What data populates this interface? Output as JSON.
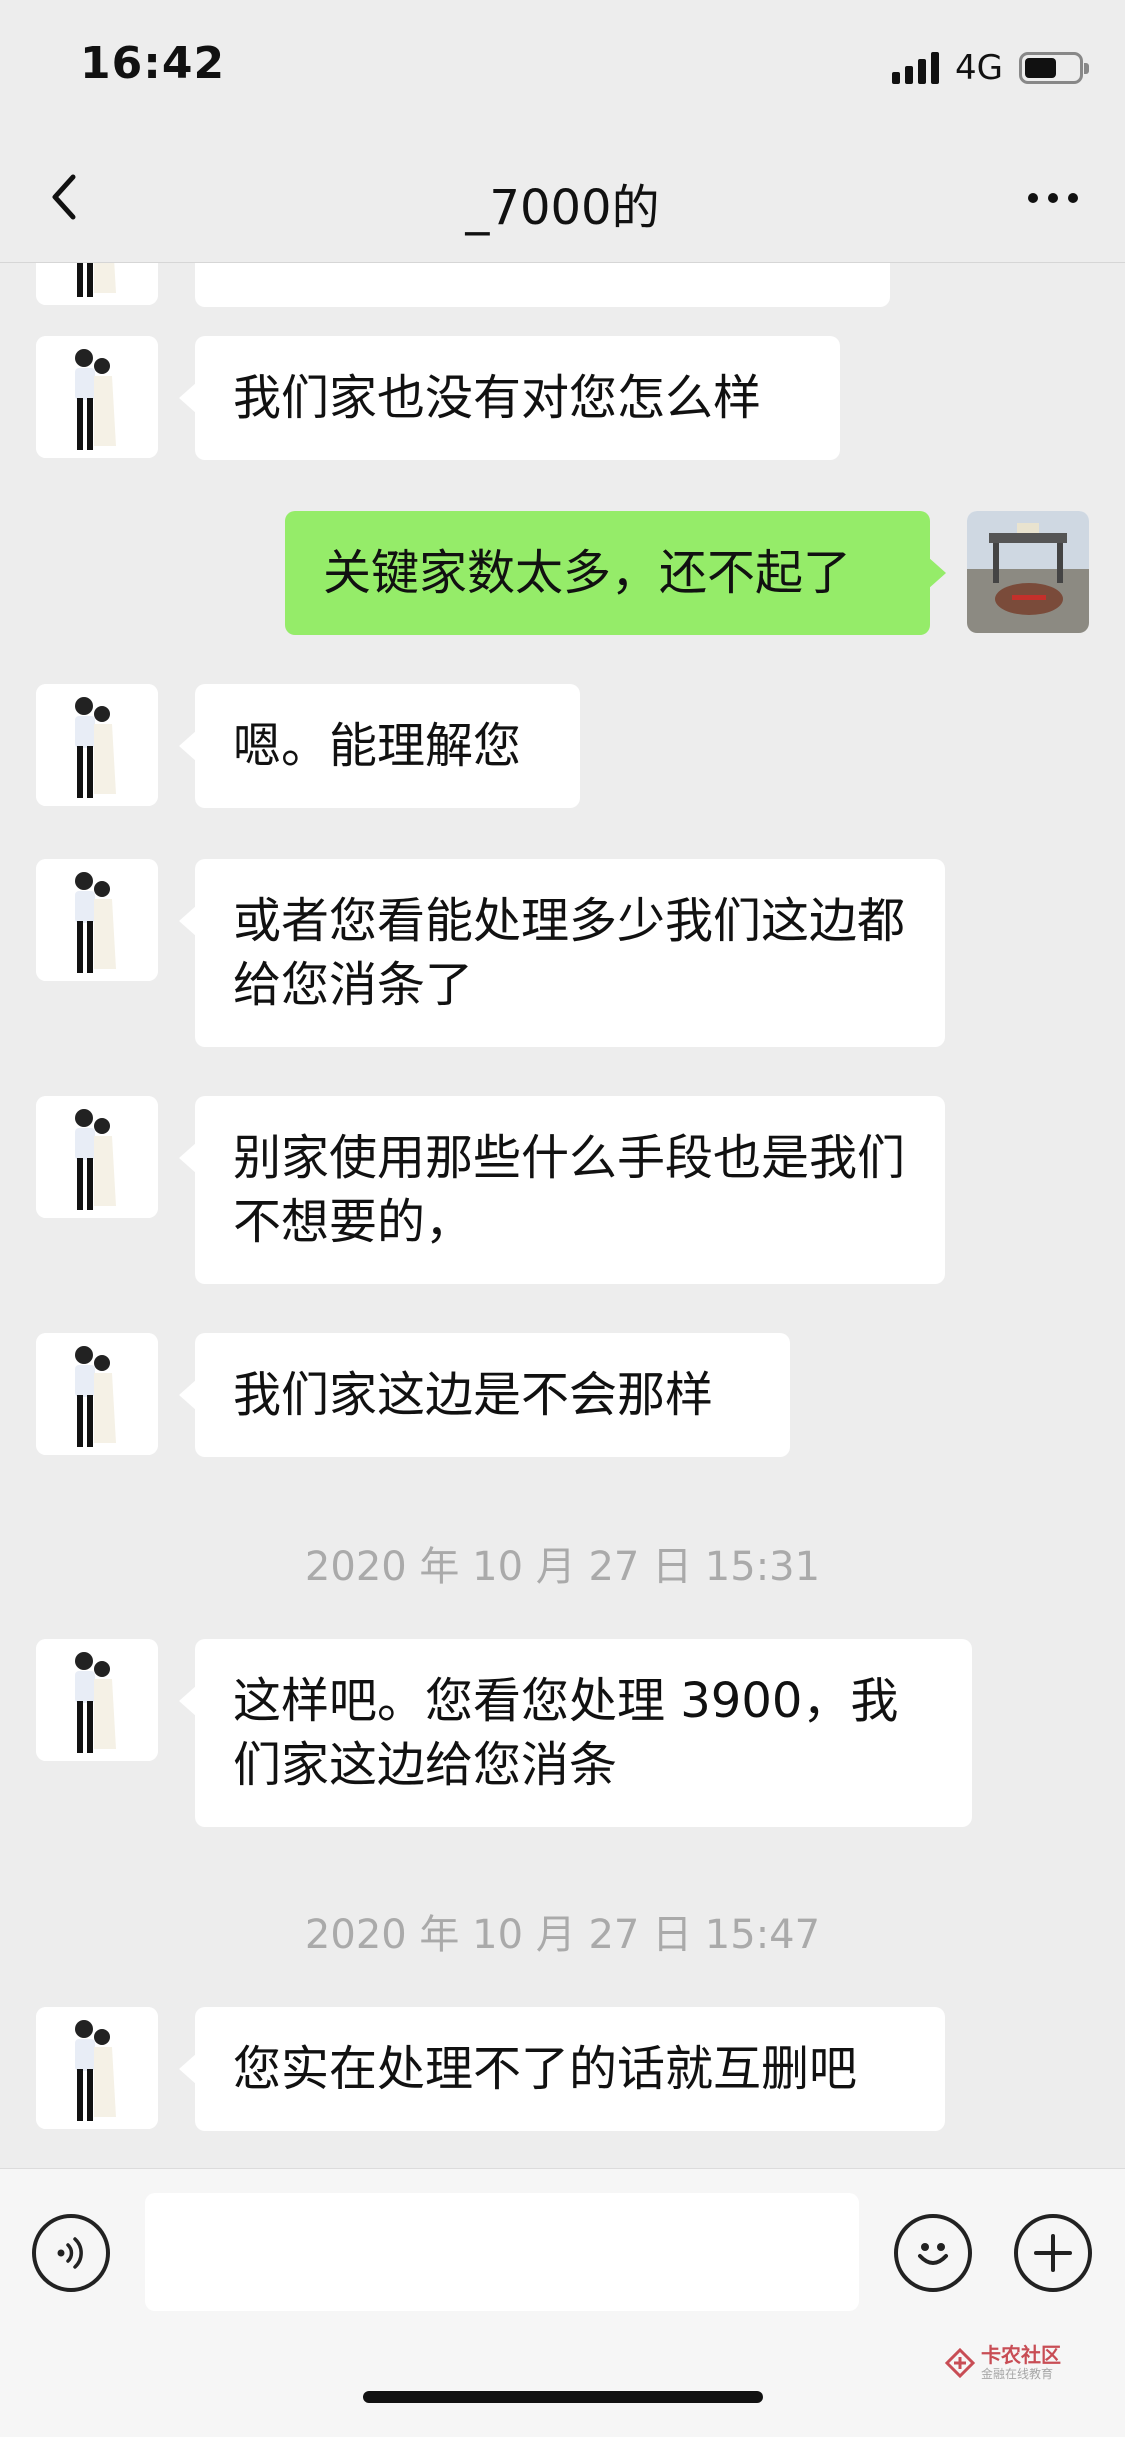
{
  "status_bar": {
    "time": "16:42",
    "network": "4G",
    "battery_level": 0.6
  },
  "nav": {
    "title": "_7000的",
    "back_icon": "chevron-left-icon",
    "more_icon": "more-dots-icon"
  },
  "messages": [
    {
      "side": "left",
      "text": "我们家也没有对您怎么样"
    },
    {
      "side": "right",
      "text": "关键家数太多，还不起了"
    },
    {
      "side": "left",
      "text": "嗯。能理解您"
    },
    {
      "side": "left",
      "text": "或者您看能处理多少我们这边都给您消条了"
    },
    {
      "side": "left",
      "text": "别家使用那些什么手段也是我们不想要的，"
    },
    {
      "side": "left",
      "text": "我们家这边是不会那样"
    },
    {
      "side": "left",
      "text": "这样吧。您看您处理 3900，我们家这边给您消条"
    },
    {
      "side": "left",
      "text": "您实在处理不了的话就互删吧"
    }
  ],
  "timestamps": [
    "2020 年 10 月 27 日  15:31",
    "2020 年 10 月 27 日  15:47"
  ],
  "input_bar": {
    "placeholder": "",
    "voice_icon": "voice-icon",
    "emoji_icon": "emoji-icon",
    "plus_icon": "plus-icon"
  },
  "watermark": {
    "title": "卡农社区",
    "subtitle": "金融在线教育"
  },
  "colors": {
    "background": "#ededed",
    "sent_bubble": "#95ec69",
    "received_bubble": "#ffffff",
    "timestamp_text": "#aaaaaa"
  }
}
